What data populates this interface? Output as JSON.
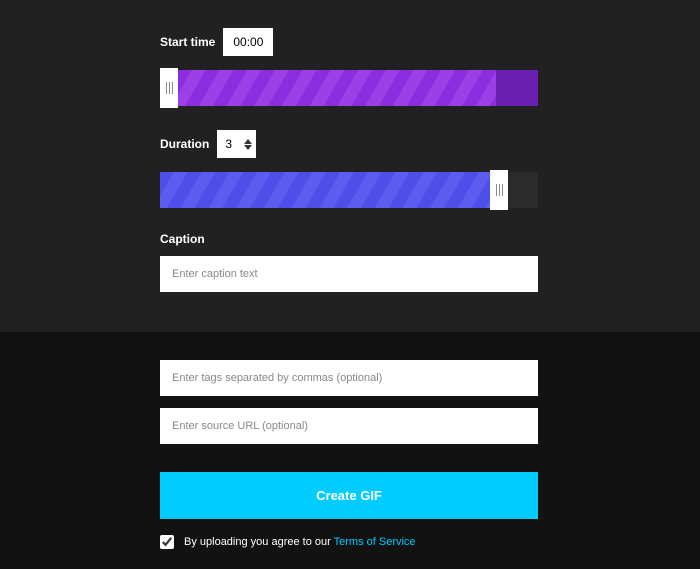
{
  "start_time": {
    "label": "Start time",
    "value": "00:00"
  },
  "duration": {
    "label": "Duration",
    "value": "3"
  },
  "caption": {
    "label": "Caption",
    "placeholder": "Enter caption text"
  },
  "tags": {
    "placeholder": "Enter tags separated by commas (optional)"
  },
  "source": {
    "placeholder": "Enter source URL (optional)"
  },
  "create_button": "Create GIF",
  "agree": {
    "text": "By uploading you agree to our ",
    "link_text": "Terms of Service"
  },
  "colors": {
    "accent": "#00ccff",
    "start_slider": "#8c2de0",
    "duration_slider": "#4e4ee8"
  }
}
